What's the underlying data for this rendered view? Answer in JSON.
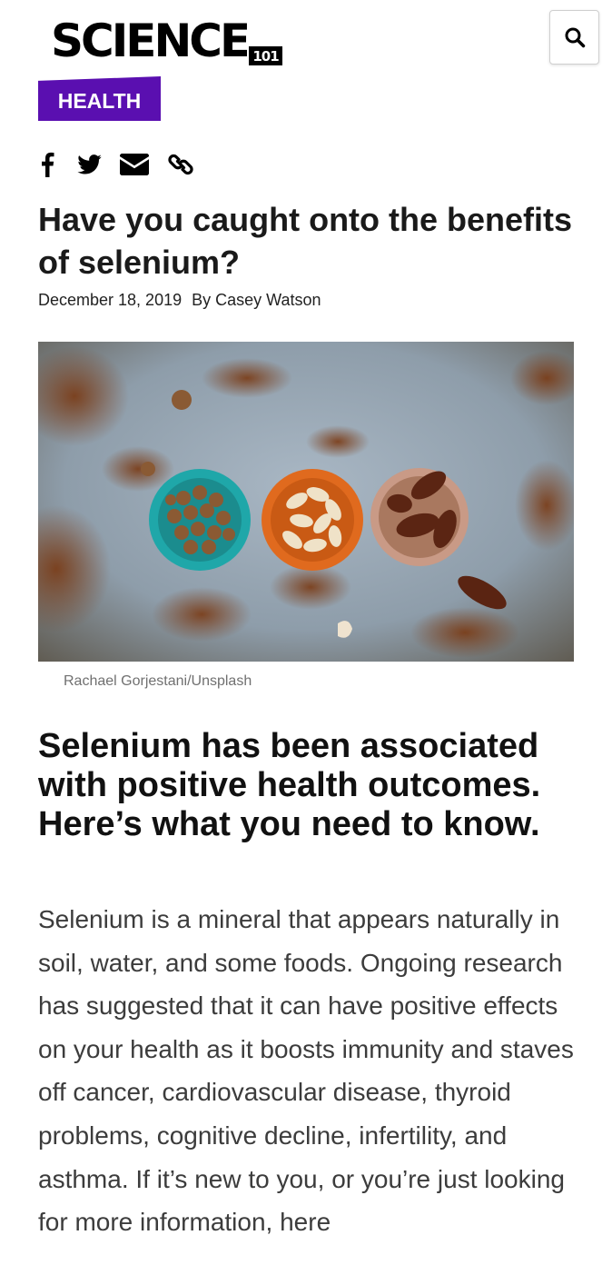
{
  "header": {
    "logo_text": "SCIENCE",
    "logo_badge": "101",
    "search_icon": "search-icon"
  },
  "article": {
    "category": "HEALTH",
    "share_icons": [
      "facebook-icon",
      "twitter-icon",
      "email-icon",
      "link-icon"
    ],
    "title": "Have you caught onto the benefits of selenium?",
    "date": "December 18, 2019",
    "author": "By Casey Watson",
    "image_caption": "Rachael Gorjestani/Unsplash",
    "subheading": "Selenium has been associated with positive health outcomes. Here’s what you need to know.",
    "body": "Selenium is a mineral that appears naturally in soil, water, and some foods. Ongoing research has suggested that it can have positive effects on your health as it boosts immunity and staves off cancer, cardiovascular disease, thyroid problems, cognitive decline, infertility, and asthma. If it’s new to you, or you’re just looking for more information, here"
  },
  "colors": {
    "brand_purple": "#5a0fb0",
    "text_dark": "#1a1a1a",
    "body_gray": "#3c3c3c",
    "caption_gray": "#707070"
  }
}
